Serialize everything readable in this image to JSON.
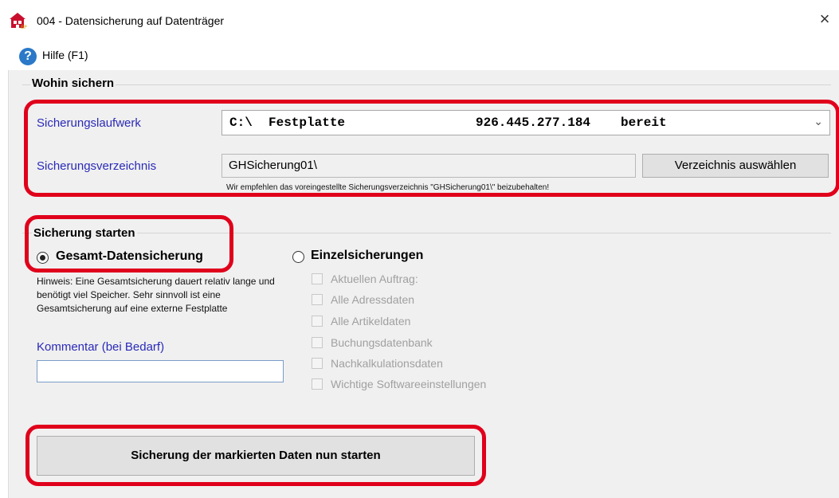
{
  "window": {
    "title": "004  -  Datensicherung auf Datenträger",
    "close": "×"
  },
  "menu": {
    "help_label": "Hilfe (F1)",
    "help_glyph": "?"
  },
  "destination": {
    "group_title": "Wohin sichern",
    "drive_label": "Sicherungslaufwerk",
    "drive_value": {
      "letter": "C:\\",
      "name": "Festplatte",
      "size": "926.445.277.184",
      "status": "bereit"
    },
    "dir_label": "Sicherungsverzeichnis",
    "dir_value": "GHSicherung01\\",
    "dir_button": "Verzeichnis auswählen",
    "dir_hint": "Wir empfehlen das voreingestellte Sicherungsverzeichnis \"GHSicherung01\\\" beizubehalten!"
  },
  "start_section": {
    "group_title": "Sicherung starten",
    "full_backup": {
      "label": "Gesamt-Datensicherung",
      "selected": true
    },
    "single_backup": {
      "label": "Einzelsicherungen",
      "selected": false
    },
    "hint": "Hinweis: Eine Gesamtsicherung dauert relativ lange und benötigt viel Speicher. Sehr sinnvoll ist eine Gesamtsicherung auf eine externe Festplatte",
    "comment_label": "Kommentar (bei Bedarf)",
    "comment_value": "",
    "options": [
      {
        "label": "Aktuellen Auftrag:",
        "checked": false,
        "enabled": false
      },
      {
        "label": "Alle Adressdaten",
        "checked": false,
        "enabled": false
      },
      {
        "label": "Alle Artikeldaten",
        "checked": false,
        "enabled": false
      },
      {
        "label": "Buchungsdatenbank",
        "checked": false,
        "enabled": false
      },
      {
        "label": "Nachkalkulationsdaten",
        "checked": false,
        "enabled": false
      },
      {
        "label": "Wichtige Softwareeinstellungen",
        "checked": false,
        "enabled": false
      }
    ],
    "start_button": "Sicherung der markierten Daten nun starten"
  },
  "colors": {
    "highlight": "#e0001b",
    "label_blue": "#2a2ab8",
    "dialog_bg": "#f0f0f0"
  }
}
